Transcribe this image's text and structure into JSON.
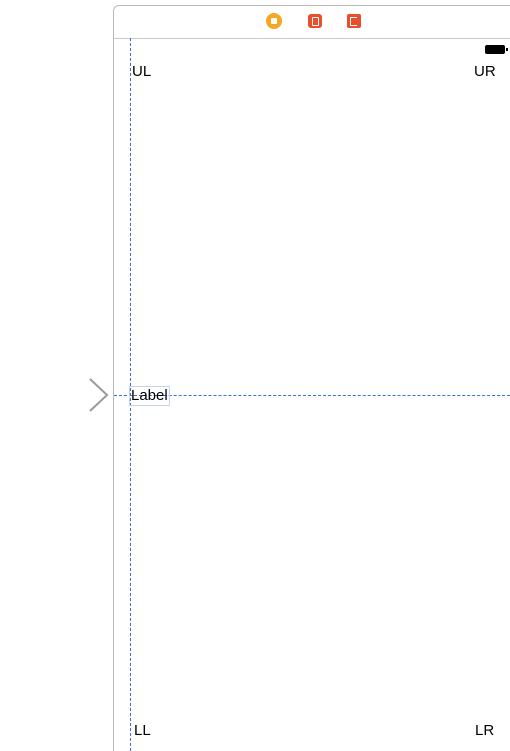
{
  "scene": {
    "dock_icons": [
      "view-controller-icon",
      "first-responder-icon",
      "exit-icon"
    ]
  },
  "labels": {
    "upper_left": "UL",
    "upper_right": "UR",
    "center": "Label",
    "lower_left": "LL",
    "lower_right": "LR"
  },
  "colors": {
    "guide": "#3a6fd8",
    "view_controller_icon": "#f5a623",
    "first_responder_icon": "#e94e2d",
    "exit_icon": "#e94e2d",
    "entry_arrow": "#9a9a9a"
  }
}
